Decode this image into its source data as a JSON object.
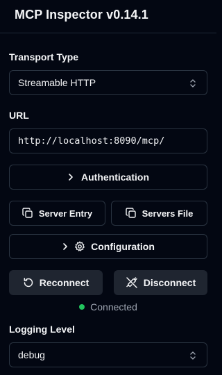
{
  "app": {
    "title": "MCP Inspector v0.14.1"
  },
  "transport": {
    "label": "Transport Type",
    "value": "Streamable HTTP"
  },
  "url": {
    "label": "URL",
    "value": "http://localhost:8090/mcp/"
  },
  "buttons": {
    "authentication": "Authentication",
    "server_entry": "Server Entry",
    "servers_file": "Servers File",
    "configuration": "Configuration",
    "reconnect": "Reconnect",
    "disconnect": "Disconnect"
  },
  "status": {
    "text": "Connected",
    "color": "#22c55e"
  },
  "logging": {
    "label": "Logging Level",
    "value": "debug"
  },
  "icons": {
    "transport_select": "chevrons-up-down-icon",
    "auth": "chevron-right-icon",
    "server_entry": "copy-icon",
    "servers_file": "copy-icon",
    "configuration": "gear-icon",
    "reconnect": "rotate-ccw-icon",
    "disconnect": "unplug-icon",
    "logging_select": "chevrons-up-down-icon"
  }
}
